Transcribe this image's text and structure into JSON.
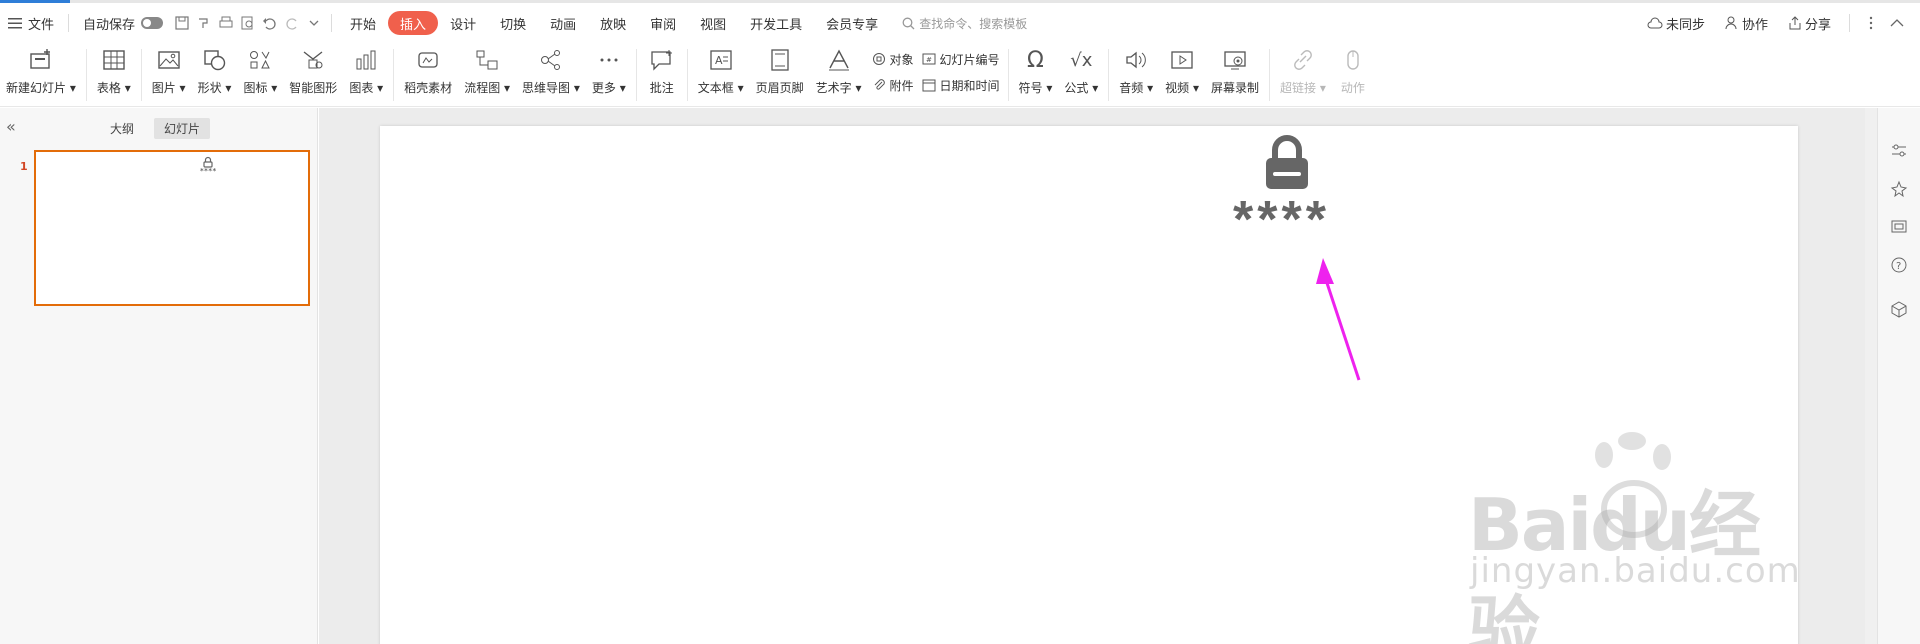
{
  "progress": {
    "value": 0.03
  },
  "menubar": {
    "file_label": "文件",
    "autosave_label": "自动保存",
    "tabs": [
      "开始",
      "插入",
      "设计",
      "切换",
      "动画",
      "放映",
      "审阅",
      "视图",
      "开发工具",
      "会员专享"
    ],
    "active_tab": "插入",
    "search_placeholder": "查找命令、搜索模板",
    "right": {
      "sync": "未同步",
      "collab": "协作",
      "share": "分享"
    }
  },
  "ribbon": {
    "new_slide": "新建幻灯片",
    "table": "表格",
    "picture": "图片",
    "shape": "形状",
    "icon": "图标",
    "smart_art": "智能图形",
    "chart": "图表",
    "material": "稻壳素材",
    "flowchart": "流程图",
    "mindmap": "思维导图",
    "more": "更多",
    "comment": "批注",
    "textbox": "文本框",
    "header_footer": "页眉页脚",
    "wordart": "艺术字",
    "object": "对象",
    "attachment": "附件",
    "slide_number": "幻灯片编号",
    "datetime": "日期和时间",
    "symbol": "符号",
    "formula": "公式",
    "audio": "音频",
    "video": "视频",
    "screen_record": "屏幕录制",
    "hyperlink": "超链接",
    "action": "动作"
  },
  "left_panel": {
    "tabs": [
      "大纲",
      "幻灯片"
    ],
    "active_tab": "幻灯片",
    "thumb_number": "1",
    "thumb_password": "****"
  },
  "slide": {
    "password_mask": "****"
  },
  "watermark": {
    "brand": "Baidu经验",
    "url": "jingyan.baidu.com"
  },
  "colors": {
    "accent_tab": "#f0604c",
    "thumb_border": "#e36c09",
    "arrow": "#ee22ee",
    "lock": "#666666"
  }
}
